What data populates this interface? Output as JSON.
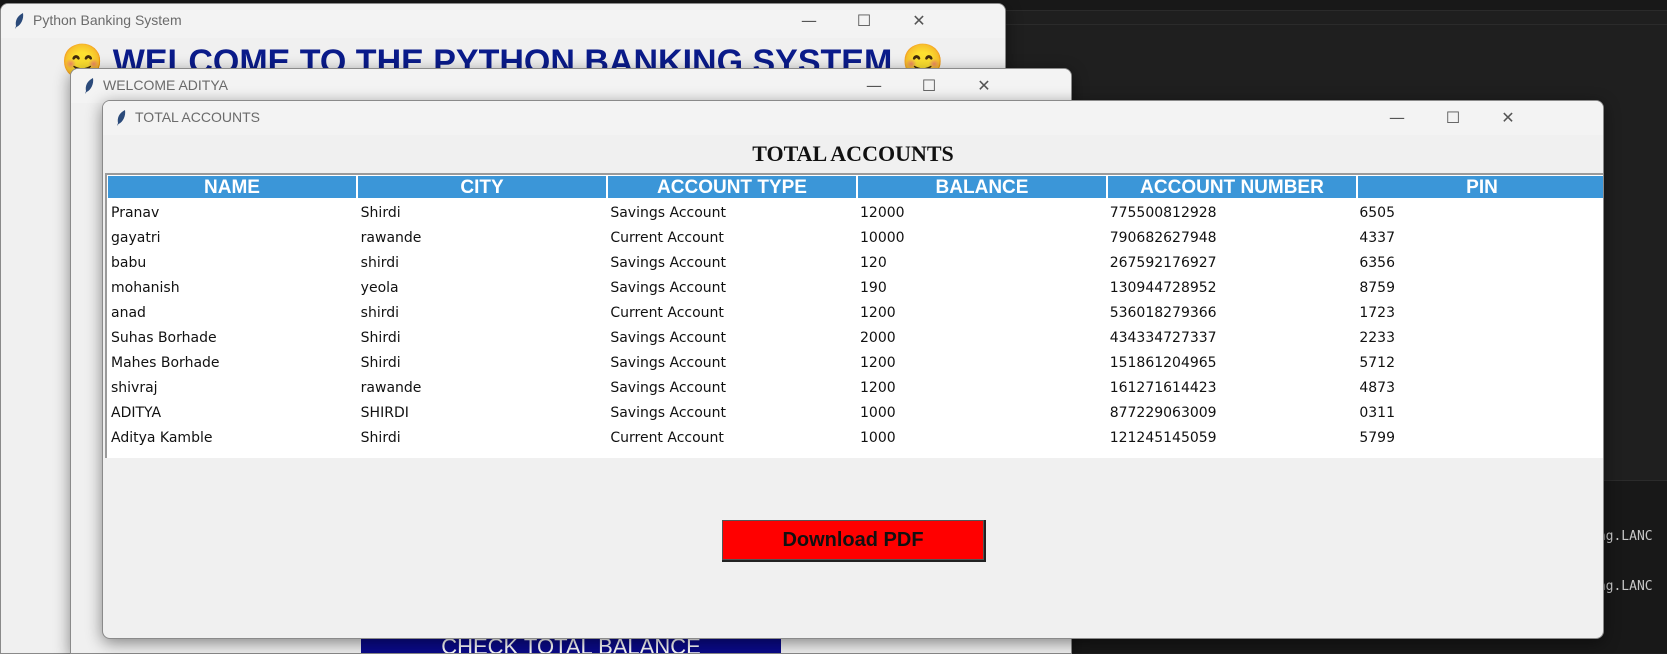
{
  "windows": {
    "main": {
      "title": "Python Banking System",
      "heading": "😊 WELCOME TO THE PYTHON BANKING SYSTEM 😊"
    },
    "welcome": {
      "title": "WELCOME ADITYA",
      "check_balance_label": "CHECK TOTAL BALANCE"
    },
    "accounts": {
      "title": "TOTAL ACCOUNTS",
      "heading": "TOTAL ACCOUNTS",
      "download_label": "Download PDF"
    }
  },
  "controls": {
    "minimize": "—",
    "maximize": "☐",
    "close": "✕"
  },
  "table": {
    "columns": [
      "NAME",
      "CITY",
      "ACCOUNT TYPE",
      "BALANCE",
      "ACCOUNT NUMBER",
      "PIN"
    ],
    "rows": [
      [
        "Pranav",
        "Shirdi",
        "Savings Account",
        "12000",
        "775500812928",
        "6505"
      ],
      [
        "gayatri",
        "rawande",
        "Current Account",
        "10000",
        "790682627948",
        "4337"
      ],
      [
        "babu",
        "shirdi",
        "Savings Account",
        "120",
        "267592176927",
        "6356"
      ],
      [
        "mohanish",
        "yeola",
        "Savings Account",
        "190",
        "130944728952",
        "8759"
      ],
      [
        "anad",
        "shirdi",
        "Current Account",
        "1200",
        "536018279366",
        "1723"
      ],
      [
        "Suhas Borhade",
        "Shirdi",
        "Savings Account",
        "2000",
        "434334727337",
        "2233"
      ],
      [
        "Mahes Borhade",
        "Shirdi",
        "Savings Account",
        "1200",
        "151861204965",
        "5712"
      ],
      [
        "shivraj",
        "rawande",
        "Savings Account",
        "1200",
        "161271614423",
        "4873"
      ],
      [
        "ADITYA",
        "SHIRDI",
        "Savings Account",
        "1000",
        "877229063009",
        "0311"
      ],
      [
        "Aditya Kamble",
        "Shirdi",
        "Current Account",
        "1000",
        "121245145059",
        "5799"
      ]
    ]
  },
  "ide": {
    "fragment_1": "ing.LANC",
    "fragment_2": "ing.LANC"
  },
  "colors": {
    "header_blue": "#3b96d8",
    "pdf_red": "#ff0000",
    "heading_navy": "#0a1b8a"
  }
}
